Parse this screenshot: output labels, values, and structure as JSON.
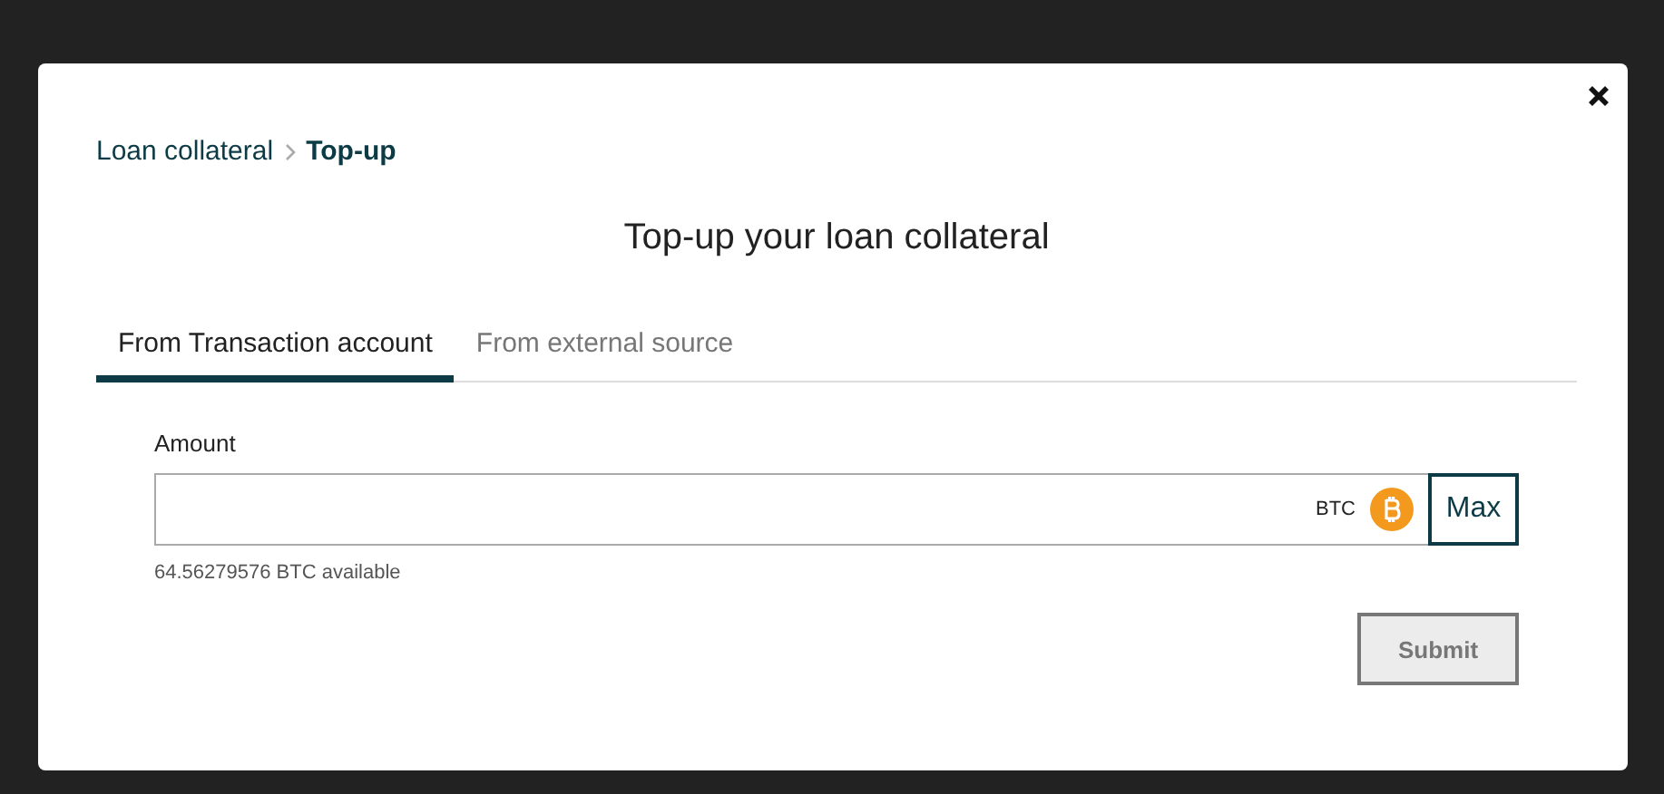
{
  "breadcrumb": [
    {
      "label": "Loan collateral",
      "current": false
    },
    {
      "label": "Top-up",
      "current": true
    }
  ],
  "title": "Top-up your loan collateral",
  "tabs": [
    {
      "label": "From Transaction account",
      "selected": true
    },
    {
      "label": "From external source",
      "selected": false
    }
  ],
  "amount": {
    "label": "Amount",
    "currency": "BTC",
    "max_label": "Max",
    "available": "64.56279576 BTC available"
  },
  "submit": {
    "label": "Submit",
    "disabled": true
  }
}
